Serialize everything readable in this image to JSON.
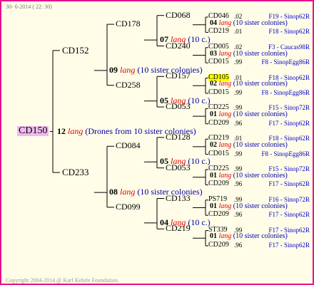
{
  "header": "30- 6-2014 ( 22: 30)",
  "footer": "Copyright 2004-2014 @ Karl Kehrle Foundation.",
  "root": {
    "name": "CD150",
    "count": "12",
    "lang": "lang",
    "note": "(Drones from 10 sister colonies)"
  },
  "gen1": [
    {
      "name": "CD152",
      "count": "09",
      "lang": "lang",
      "note": "(10 sister colonies)"
    },
    {
      "name": "CD233",
      "count": "08",
      "lang": "lang",
      "note": "(10 sister colonies)"
    }
  ],
  "gen2": [
    {
      "name": "CD178",
      "count": "07",
      "lang": "lang",
      "note": "(10 c.)"
    },
    {
      "name": "CD258",
      "count": "05",
      "lang": "lang",
      "note": "(10 c.)"
    },
    {
      "name": "CD084",
      "count": "05",
      "lang": "lang",
      "note": "(10 c.)"
    },
    {
      "name": "CD099",
      "count": "04",
      "lang": "lang",
      "note": "(10 c.)"
    }
  ],
  "gen3": [
    {
      "name": "CD068",
      "count": "04",
      "lang": "lang",
      "note": "(10 sister colonies)"
    },
    {
      "name": "CD240",
      "count": "03",
      "lang": "lang",
      "note": "(10 sister colonies)"
    },
    {
      "name": "CD157",
      "count": "02",
      "lang": "lang",
      "note": "(10 sister colonies)"
    },
    {
      "name": "CD053",
      "count": "01",
      "lang": "lang",
      "note": "(10 sister colonies)"
    },
    {
      "name": "CD128",
      "count": "02",
      "lang": "lang",
      "note": "(10 sister colonies)"
    },
    {
      "name": "CD053",
      "count": "01",
      "lang": "lang",
      "note": "(10 sister colonies)"
    },
    {
      "name": "CD133",
      "count": "01",
      "lang": "lang",
      "note": "(10 sister colonies)"
    },
    {
      "name": "CD219",
      "count": "01",
      "lang": "lang",
      "note": "(10 sister colonies)"
    }
  ],
  "gen4": [
    {
      "name": "CD046",
      "year": ".02",
      "info": "F19 - Sinop62R",
      "highlight": false
    },
    {
      "name": "CD219",
      "year": ".01",
      "info": "F18 - Sinop62R",
      "highlight": false
    },
    {
      "name": "CD005",
      "year": ".02",
      "info": "F3 - Caucas98R",
      "highlight": false
    },
    {
      "name": "CD015",
      "year": ".99",
      "info": "F8 - SinopEgg86R",
      "highlight": false
    },
    {
      "name": "CD105",
      "year": ".01",
      "info": "F18 - Sinop62R",
      "highlight": true
    },
    {
      "name": "CD015",
      "year": ".99",
      "info": "F8 - SinopEgg86R",
      "highlight": false
    },
    {
      "name": "CD225",
      "year": ".99",
      "info": "F15 - Sinop72R",
      "highlight": false
    },
    {
      "name": "CD209",
      "year": ".96",
      "info": "F17 - Sinop62R",
      "highlight": false
    },
    {
      "name": "CD219",
      "year": ".01",
      "info": "F18 - Sinop62R",
      "highlight": false
    },
    {
      "name": "CD015",
      "year": ".99",
      "info": "F8 - SinopEgg86R",
      "highlight": false
    },
    {
      "name": "CD225",
      "year": ".99",
      "info": "F15 - Sinop72R",
      "highlight": false
    },
    {
      "name": "CD209",
      "year": ".96",
      "info": "F17 - Sinop62R",
      "highlight": false
    },
    {
      "name": "PS719",
      "year": ".99",
      "info": "F16 - Sinop72R",
      "highlight": false
    },
    {
      "name": "CD209",
      "year": ".96",
      "info": "F17 - Sinop62R",
      "highlight": false
    },
    {
      "name": "ST339",
      "year": ".99",
      "info": "F17 - Sinop62R",
      "highlight": false
    },
    {
      "name": "CD209",
      "year": ".96",
      "info": "F17 - Sinop62R",
      "highlight": false
    }
  ]
}
